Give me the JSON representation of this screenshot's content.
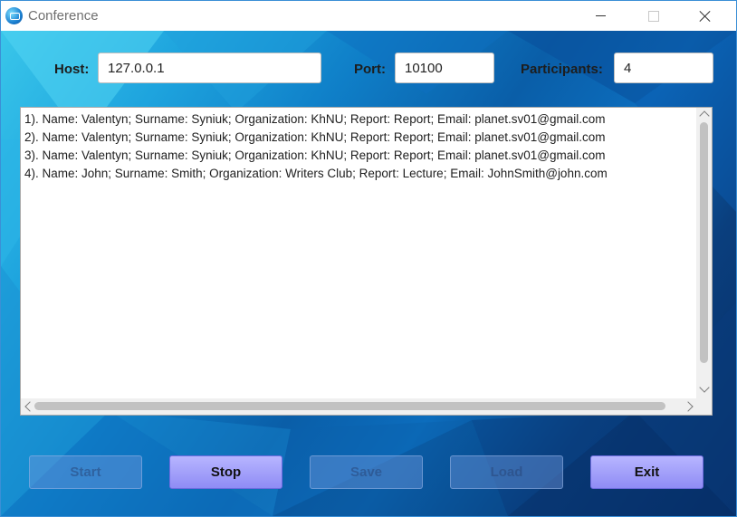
{
  "window": {
    "title": "Conference"
  },
  "form": {
    "host_label": "Host:",
    "host_value": "127.0.0.1",
    "port_label": "Port:",
    "port_value": "10100",
    "participants_label": "Participants:",
    "participants_value": "4"
  },
  "list": {
    "rows": [
      "1). Name: Valentyn; Surname: Syniuk; Organization: KhNU; Report: Report; Email: planet.sv01@gmail.com",
      "2). Name: Valentyn; Surname: Syniuk; Organization: KhNU; Report: Report; Email: planet.sv01@gmail.com",
      "3). Name: Valentyn; Surname: Syniuk; Organization: KhNU; Report: Report; Email: planet.sv01@gmail.com",
      "4). Name: John; Surname: Smith; Organization: Writers Club; Report: Lecture; Email: JohnSmith@john.com"
    ]
  },
  "buttons": {
    "start": {
      "label": "Start",
      "enabled": false
    },
    "stop": {
      "label": "Stop",
      "enabled": true
    },
    "save": {
      "label": "Save",
      "enabled": false
    },
    "load": {
      "label": "Load",
      "enabled": false
    },
    "exit": {
      "label": "Exit",
      "enabled": true
    }
  },
  "colors": {
    "button_enabled": "#9d9afa",
    "background_light": "#39c6ea",
    "background_dark": "#062b63"
  }
}
